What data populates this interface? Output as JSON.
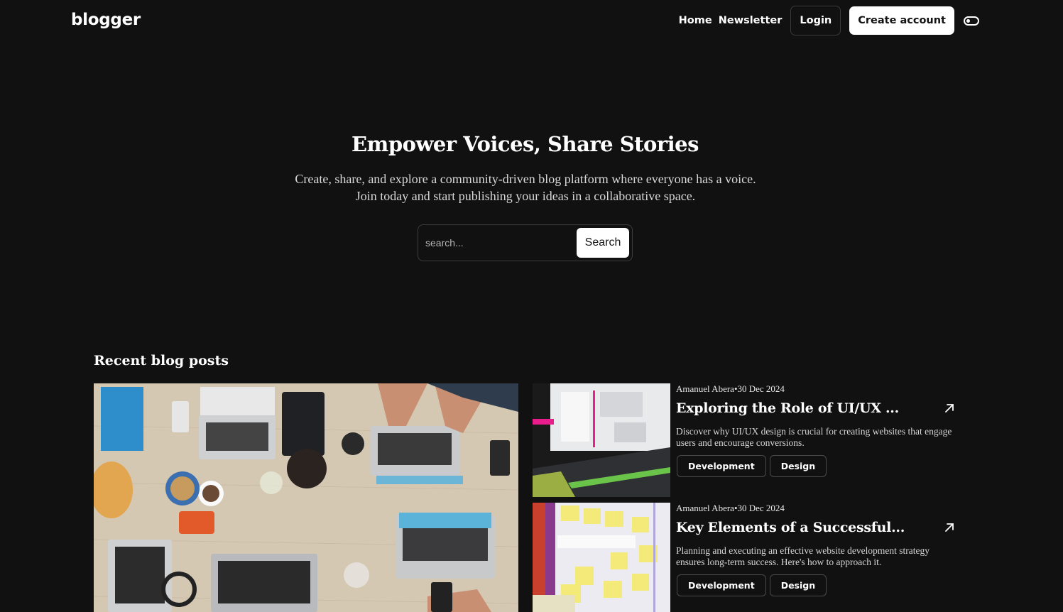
{
  "header": {
    "logo": "blogger",
    "nav": {
      "home": "Home",
      "newsletter": "Newsletter",
      "login": "Login",
      "create_account": "Create account"
    }
  },
  "hero": {
    "title": "Empower Voices, Share Stories",
    "subtitle": "Create, share, and explore a community-driven blog platform where everyone has a voice. Join today and start publishing your ideas in a collaborative space.",
    "search": {
      "placeholder": "search...",
      "button": "Search"
    }
  },
  "recent": {
    "title": "Recent blog posts",
    "posts": [
      {
        "meta": "Amanuel Abera•30 Dec 2024",
        "title": "Exploring the Role of UI/UX ...",
        "description": "Discover why UI/UX design is crucial for creating websites that engage users and encourage conversions.",
        "tags": [
          "Development",
          "Design"
        ]
      },
      {
        "meta": "Amanuel Abera•30 Dec 2024",
        "title": "Key Elements of a Successful...",
        "description": "Planning and executing an effective website development strategy ensures long-term success. Here's how to approach it.",
        "tags": [
          "Development",
          "Design"
        ]
      }
    ]
  },
  "icons": {
    "theme_toggle": "toggle-icon",
    "post_link": "arrow-up-right-icon"
  },
  "colors": {
    "background": "#121112",
    "text": "#ffffff",
    "border": "#3c3c3c"
  }
}
